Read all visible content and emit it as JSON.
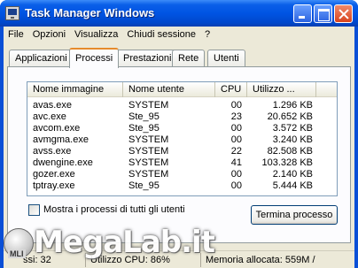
{
  "window": {
    "title": "Task Manager Windows"
  },
  "menu": [
    "File",
    "Opzioni",
    "Visualizza",
    "Chiudi sessione",
    "?"
  ],
  "tabs": [
    {
      "label": "Applicazioni",
      "active": false
    },
    {
      "label": "Processi",
      "active": true
    },
    {
      "label": "Prestazioni",
      "active": false
    },
    {
      "label": "Rete",
      "active": false
    },
    {
      "label": "Utenti",
      "active": false
    }
  ],
  "list": {
    "columns": {
      "name": "Nome immagine",
      "user": "Nome utente",
      "cpu": "CPU",
      "mem": "Utilizzo ..."
    },
    "rows": [
      {
        "name": "avas.exe",
        "user": "SYSTEM",
        "cpu": "00",
        "mem": "1.296 KB"
      },
      {
        "name": "avc.exe",
        "user": "Ste_95",
        "cpu": "23",
        "mem": "20.652 KB"
      },
      {
        "name": "avcom.exe",
        "user": "Ste_95",
        "cpu": "00",
        "mem": "3.572 KB"
      },
      {
        "name": "avmgma.exe",
        "user": "SYSTEM",
        "cpu": "00",
        "mem": "3.240 KB"
      },
      {
        "name": "avss.exe",
        "user": "SYSTEM",
        "cpu": "22",
        "mem": "82.508 KB"
      },
      {
        "name": "dwengine.exe",
        "user": "SYSTEM",
        "cpu": "41",
        "mem": "103.328 KB"
      },
      {
        "name": "gozer.exe",
        "user": "SYSTEM",
        "cpu": "00",
        "mem": "2.140 KB"
      },
      {
        "name": "tptray.exe",
        "user": "Ste_95",
        "cpu": "00",
        "mem": "5.444 KB"
      }
    ]
  },
  "show_all_label": "Mostra i processi di tutti gli utenti",
  "end_process_label": "Termina processo",
  "status": {
    "processes": "ssi: 32",
    "cpu": "Utilizzo CPU: 86%",
    "memory": "Memoria allocata: 559M /"
  },
  "watermark": {
    "text": "MegaLab.it",
    "logo_text": "MLI"
  }
}
